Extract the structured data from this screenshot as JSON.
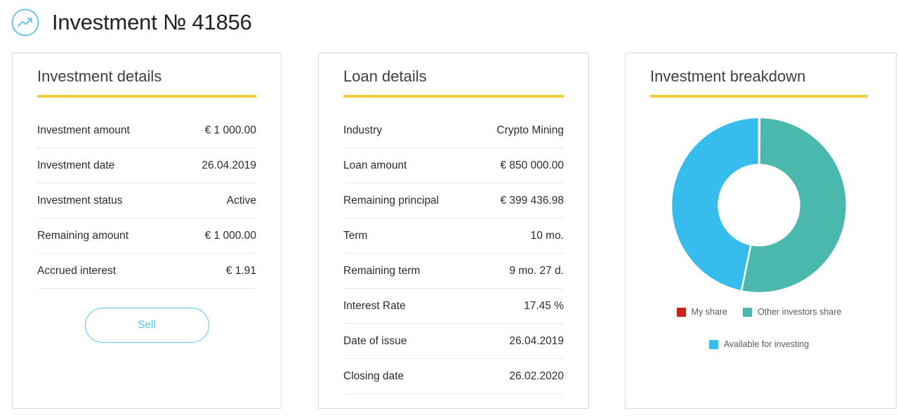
{
  "header": {
    "icon": "trending-up-circle-icon",
    "title": "Investment № 41856"
  },
  "cards": {
    "investment_details": {
      "title": "Investment details",
      "rows": [
        {
          "label": "Investment amount",
          "value": "€ 1 000.00"
        },
        {
          "label": "Investment date",
          "value": "26.04.2019"
        },
        {
          "label": "Investment status",
          "value": "Active"
        },
        {
          "label": "Remaining amount",
          "value": "€ 1 000.00"
        },
        {
          "label": "Accrued interest",
          "value": "€ 1.91"
        }
      ],
      "sell_button_label": "Sell"
    },
    "loan_details": {
      "title": "Loan details",
      "rows": [
        {
          "label": "Industry",
          "value": "Crypto Mining"
        },
        {
          "label": "Loan amount",
          "value": "€ 850 000.00"
        },
        {
          "label": "Remaining principal",
          "value": "€ 399 436.98"
        },
        {
          "label": "Term",
          "value": "10 mo."
        },
        {
          "label": "Remaining term",
          "value": "9 mo. 27 d."
        },
        {
          "label": "Interest Rate",
          "value": "17.45 %"
        },
        {
          "label": "Date of issue",
          "value": "26.04.2019"
        },
        {
          "label": "Closing date",
          "value": "26.02.2020"
        }
      ]
    },
    "investment_breakdown": {
      "title": "Investment breakdown"
    }
  },
  "chart_data": {
    "type": "pie",
    "title": "Investment breakdown",
    "donut": true,
    "inner_radius_ratio": 0.46,
    "start_angle_deg": 0,
    "direction": "clockwise",
    "legend_position": "bottom",
    "categories": [
      "My share",
      "Other investors share",
      "Available for investing"
    ],
    "values": [
      0.12,
      53.1,
      46.78
    ],
    "unit": "%",
    "colors": [
      "#d0201a",
      "#4ab8ac",
      "#36bdee"
    ],
    "slices": [
      {
        "label": "My share",
        "value": 0.12,
        "color": "#d0201a"
      },
      {
        "label": "Other investors share",
        "value": 53.1,
        "color": "#4ab8ac"
      },
      {
        "label": "Available for investing",
        "value": 46.78,
        "color": "#36bdee"
      }
    ]
  },
  "theme": {
    "accent_yellow": "#efce3f",
    "accent_blue": "#5dc4ea",
    "card_border": "#d8d9dc",
    "row_divider": "#e9eaec",
    "text_primary": "#2b2b33",
    "text_title": "#3e3e47",
    "legend_text": "#5a5a63"
  }
}
